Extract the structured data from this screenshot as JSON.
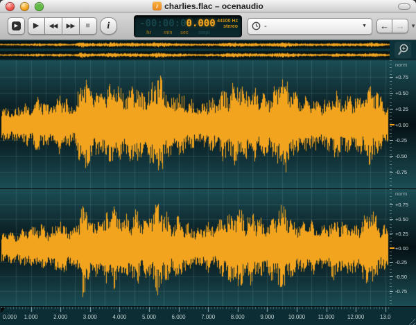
{
  "window": {
    "title": "charlies.flac – ocenaudio"
  },
  "icons": {
    "note": "♪",
    "mini_play": "▶",
    "play": "▶",
    "rewind": "◀◀",
    "forward": "▶▶",
    "stop": "■",
    "info": "i",
    "left_arrow": "←",
    "right_arrow": "→",
    "combo_caret": "▼",
    "caret": "▼"
  },
  "toolbar": {
    "clock_value": "-"
  },
  "time_display": {
    "dim_digits": "-00:00:0",
    "value": "0.000",
    "unit_labels": [
      "hr",
      "min",
      "sec",
      "smpl"
    ],
    "sample_rate": "44100 Hz",
    "channel_mode": "stereo"
  },
  "scale": {
    "top_label": "norm",
    "labels": [
      "+0.75",
      "+0.50",
      "+0.25",
      "+0.00",
      "-0.25",
      "-0.50",
      "-0.75"
    ],
    "values": [
      0.75,
      0.5,
      0.25,
      0,
      -0.25,
      -0.5,
      -0.75
    ],
    "range": 1.02
  },
  "timeline": {
    "labels": [
      "0.000",
      "1.000",
      "2.000",
      "3.000",
      "4.000",
      "5.000",
      "6.000",
      "7.000",
      "8.000",
      "9.000",
      "10.000",
      "11.000",
      "12.000",
      "13.0"
    ]
  },
  "waveform": {
    "duration_sec": 13.1,
    "step_sec": 0.25,
    "channels": 2,
    "channel_seeds": [
      3,
      11
    ],
    "envelope": [
      0.24,
      0.28,
      0.26,
      0.32,
      0.34,
      0.46,
      0.32,
      0.36,
      0.5,
      0.36,
      0.32,
      0.88,
      0.56,
      0.5,
      0.56,
      0.74,
      0.6,
      0.55,
      0.68,
      0.52,
      0.56,
      0.78,
      0.68,
      0.46,
      0.55,
      0.42,
      0.36,
      0.32,
      0.46,
      0.36,
      0.55,
      0.6,
      0.7,
      0.56,
      0.64,
      0.5,
      0.46,
      0.6,
      0.84,
      0.6,
      0.5,
      0.42,
      0.46,
      0.36,
      0.42,
      0.55,
      0.46,
      0.5,
      0.42,
      0.55,
      0.68,
      0.5,
      0.36
    ]
  },
  "colors": {
    "waveform": "#f2a41f",
    "bg_edge": "#1c4e56",
    "bg_center": "#051114",
    "grid": "rgba(150,195,200,0.16)",
    "axis_bg": "#0b2d33",
    "overview_bg": "#0e373d",
    "overview_band": "#071416"
  }
}
